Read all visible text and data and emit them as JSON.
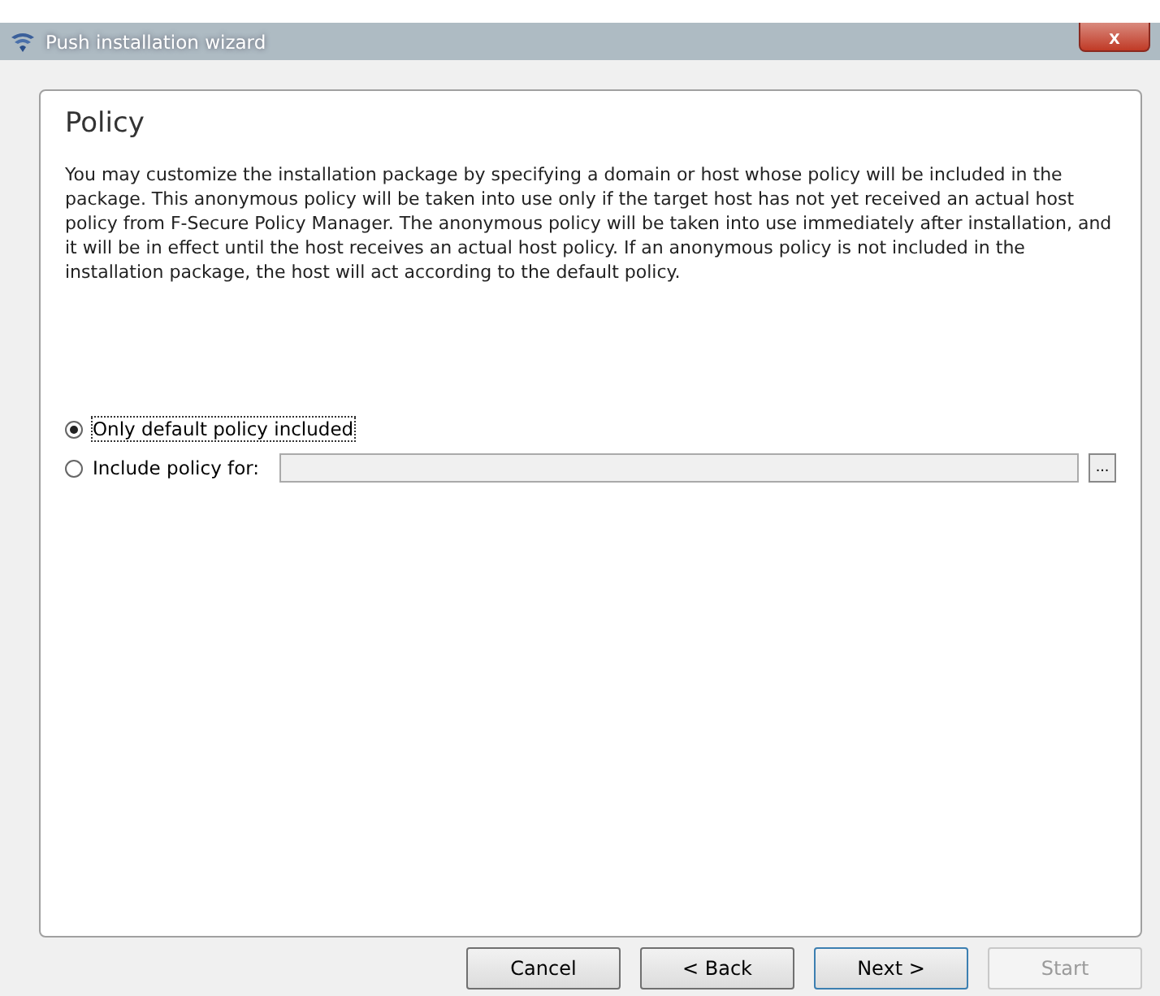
{
  "window": {
    "title": "Push installation wizard",
    "close": "x"
  },
  "page": {
    "heading": "Policy",
    "description": "You may customize the installation package by specifying a domain or host whose policy will be included in the package. This anonymous policy will be taken into use only if the target host has not yet received an actual host policy from F-Secure Policy Manager. The anonymous policy will be taken into use immediately after installation, and it will be in effect until the host receives an actual host policy. If an anonymous policy is not included in the installation package, the host will act according to the default policy."
  },
  "options": [
    {
      "label": "Only default policy included",
      "selected": true,
      "focused": true,
      "kind": "plain"
    },
    {
      "label": "Include policy for:",
      "selected": false,
      "focused": false,
      "kind": "field",
      "field_disabled": true,
      "browse": "..."
    }
  ],
  "buttons": [
    {
      "label": "Cancel",
      "default": false,
      "disabled": false
    },
    {
      "label": "< Back",
      "default": false,
      "disabled": false
    },
    {
      "label": "Next >",
      "default": true,
      "disabled": false
    },
    {
      "label": "Start",
      "default": false,
      "disabled": true
    }
  ]
}
